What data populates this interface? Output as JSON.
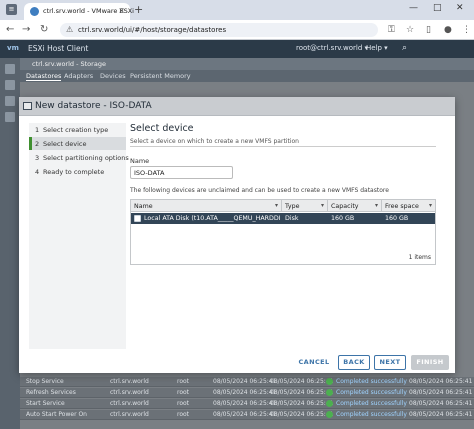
{
  "browser": {
    "tab_title": "ctrl.srv.world - VMware ESXi",
    "tab_close": "×",
    "new_tab": "+",
    "minimize": "—",
    "maximize": "□",
    "close": "✕",
    "url": "ctrl.srv.world/ui/#/host/storage/datastores"
  },
  "esxi": {
    "logo": "vm",
    "title": "ESXi Host Client",
    "user": "root@ctrl.srv.world ▾",
    "help": "Help ▾",
    "breadcrumb": "ctrl.srv.world - Storage",
    "subtabs": [
      "Datastores",
      "Adapters",
      "Devices",
      "Persistent Memory"
    ],
    "background_rows": [
      {
        "task": "Stop Service",
        "target": "ctrl.srv.world",
        "initiator": "root",
        "queued": "08/05/2024 06:25:41",
        "started": "08/05/2024 06:25:41",
        "result": "Completed successfully",
        "completed": "08/05/2024 06:25:41"
      },
      {
        "task": "Refresh Services",
        "target": "ctrl.srv.world",
        "initiator": "root",
        "queued": "08/05/2024 06:25:41",
        "started": "08/05/2024 06:25:41",
        "result": "Completed successfully",
        "completed": "08/05/2024 06:25:41"
      },
      {
        "task": "Start Service",
        "target": "ctrl.srv.world",
        "initiator": "root",
        "queued": "08/05/2024 06:25:41",
        "started": "08/05/2024 06:25:41",
        "result": "Completed successfully",
        "completed": "08/05/2024 06:25:41"
      },
      {
        "task": "Auto Start Power On",
        "target": "ctrl.srv.world",
        "initiator": "root",
        "queued": "08/05/2024 06:25:41",
        "started": "08/05/2024 06:25:41",
        "result": "Completed successfully",
        "completed": "08/05/2024 06:25:41"
      }
    ]
  },
  "wizard": {
    "title": "New datastore - ISO-DATA",
    "steps": [
      {
        "num": "1",
        "label": "Select creation type"
      },
      {
        "num": "2",
        "label": "Select device"
      },
      {
        "num": "3",
        "label": "Select partitioning options"
      },
      {
        "num": "4",
        "label": "Ready to complete"
      }
    ],
    "active_step": 2,
    "heading": "Select device",
    "subheading": "Select a device on which to create a new VMFS partition",
    "name_label": "Name",
    "name_value": "ISO-DATA",
    "note": "The following devices are unclaimed and can be used to create a new VMFS datastore",
    "columns": [
      "Name",
      "Type",
      "Capacity",
      "Free space"
    ],
    "sort_arrow": "▾",
    "device": {
      "name": "Local ATA Disk (t10.ATA_____QEMU_HARDDI...",
      "type": "Disk",
      "capacity": "160 GB",
      "free": "160 GB"
    },
    "item_count": "1 items",
    "buttons": {
      "cancel": "CANCEL",
      "back": "BACK",
      "next": "NEXT",
      "finish": "FINISH"
    }
  },
  "colors": {
    "accent": "#3d74a8",
    "header_bg": "#2b3a48",
    "selected_row": "#324557",
    "step_marker": "#3f8f2f"
  }
}
